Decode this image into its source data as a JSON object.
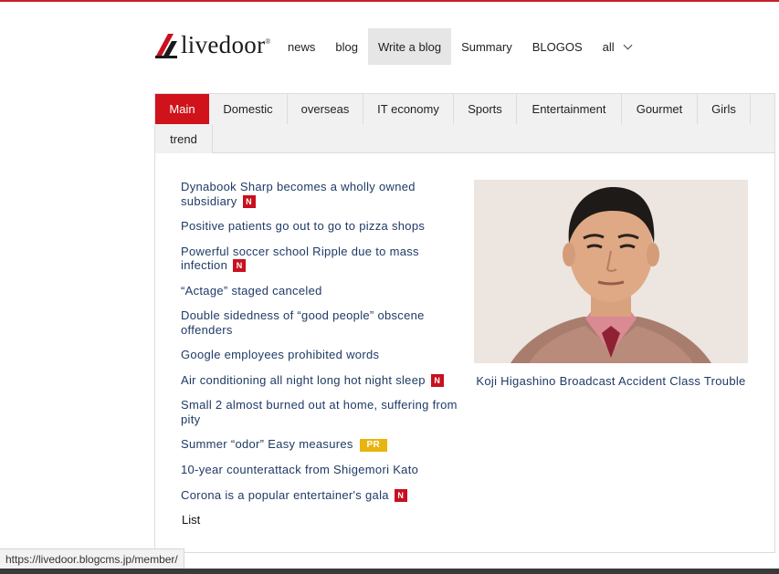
{
  "site": {
    "logo_text": "livedoor",
    "logo_reg": "®"
  },
  "nav": [
    {
      "label": "news"
    },
    {
      "label": "blog"
    },
    {
      "label": "Write a blog",
      "active": true
    },
    {
      "label": "Summary"
    },
    {
      "label": "BLOGOS"
    },
    {
      "label": "all"
    }
  ],
  "tabs": [
    {
      "label": "Main",
      "active": true
    },
    {
      "label": "Domestic"
    },
    {
      "label": "overseas"
    },
    {
      "label": "IT economy"
    },
    {
      "label": "Sports"
    },
    {
      "label": "Entertainment"
    },
    {
      "label": "Gourmet"
    },
    {
      "label": "Girls"
    },
    {
      "label": "trend"
    }
  ],
  "news": [
    {
      "text": "Dynabook Sharp becomes a wholly owned subsidiary",
      "badge": "N"
    },
    {
      "text": "Positive patients go out to go to pizza shops",
      "badge": ""
    },
    {
      "text": "Powerful soccer school Ripple due to mass infection",
      "badge": "N"
    },
    {
      "text": "“Actage” staged canceled",
      "badge": ""
    },
    {
      "text": "Double sidedness of “good people” obscene offenders",
      "badge": ""
    },
    {
      "text": "Google employees prohibited words",
      "badge": ""
    },
    {
      "text": "Air conditioning all night long hot night sleep",
      "badge": "N"
    },
    {
      "text": "Small 2 almost burned out at home, suffering from pity",
      "badge": ""
    },
    {
      "text": "Summer “odor” Easy measures",
      "badge": "PR"
    },
    {
      "text": "10-year counterattack from Shigemori Kato",
      "badge": ""
    },
    {
      "text": "Corona is a popular entertainer's gala",
      "badge": "N"
    }
  ],
  "list_link": "List",
  "feature": {
    "caption": "Koji Higashino Broadcast Accident Class Trouble"
  },
  "status_url": "https://livedoor.blogcms.jp/member/",
  "colors": {
    "brand_red": "#d0121b",
    "link_blue": "#1f3a66",
    "pr_yellow": "#e8b40e"
  }
}
